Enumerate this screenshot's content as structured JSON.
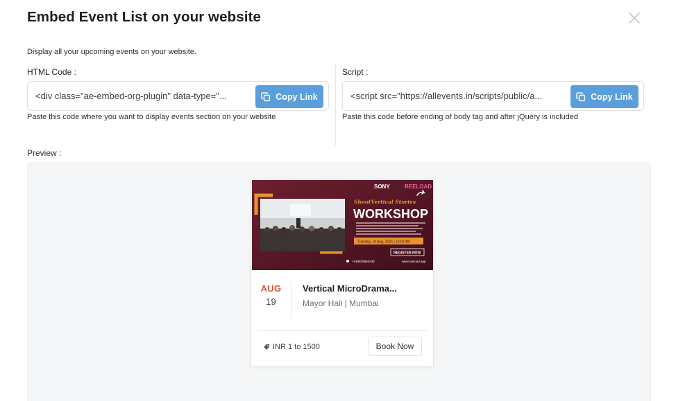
{
  "dialog": {
    "title": "Embed Event List on your website",
    "subtitle": "Display all your upcoming events on your website.",
    "preview_label": "Preview :"
  },
  "html_code": {
    "label": "HTML Code :",
    "value": "<div class=\"ae-embed-org-plugin\" data-type=\"...",
    "copy_label": "Copy Link",
    "helper": "Paste this code where you want to display events section on your website"
  },
  "script": {
    "label": "Script :",
    "value": "<script src=\"https://allevents.in/scripts/public/a...",
    "copy_label": "Copy Link",
    "helper": "Paste this code before ending of body tag and after jQuery is included"
  },
  "event": {
    "banner": {
      "brand_sony": "SONY",
      "brand_reeload": "REELOAD",
      "tagline": "ShootVertical Stories",
      "headline": "WORKSHOP",
      "date_line": "Tuesday, 19 Aug, 2025 | 10:00 AM",
      "register": "REGISTER NOW",
      "phone": "+919819663439",
      "website": "www.reeload.app"
    },
    "month": "AUG",
    "day": "19",
    "title": "Vertical MicroDrama...",
    "location": "Mayor Hall | Mumbai",
    "price": "INR 1 to 1500",
    "book_label": "Book Now"
  },
  "colors": {
    "copy_button": "#5a9fd9",
    "month_accent": "#e0543f",
    "banner_bg": "#5a1a27",
    "banner_accent": "#e9932f"
  }
}
